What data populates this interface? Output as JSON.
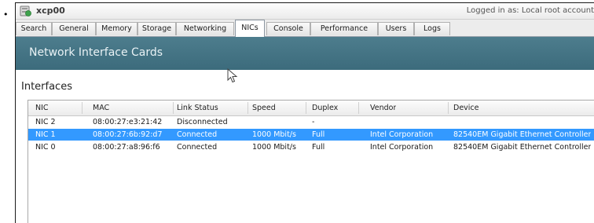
{
  "titlebar": {
    "host_name": "xcp00",
    "logged_in_text": "Logged in as: Local root account"
  },
  "tabs": [
    {
      "label": "Search",
      "active": false
    },
    {
      "label": "General",
      "active": false
    },
    {
      "label": "Memory",
      "active": false
    },
    {
      "label": "Storage",
      "active": false
    },
    {
      "label": "Networking",
      "active": false
    },
    {
      "label": "NICs",
      "active": true
    },
    {
      "label": "Console",
      "active": false
    },
    {
      "label": "Performance",
      "active": false
    },
    {
      "label": "Users",
      "active": false
    },
    {
      "label": "Logs",
      "active": false
    }
  ],
  "banner": {
    "title": "Network Interface Cards"
  },
  "interfaces": {
    "title": "Interfaces",
    "columns": [
      "NIC",
      "MAC",
      "Link Status",
      "Speed",
      "Duplex",
      "Vendor",
      "Device"
    ],
    "rows": [
      {
        "nic": "NIC 2",
        "mac": "08:00:27:e3:21:42",
        "link_status": "Disconnected",
        "speed": "",
        "duplex": "-",
        "vendor": "",
        "device": "",
        "selected": false
      },
      {
        "nic": "NIC 1",
        "mac": "08:00:27:6b:92:d7",
        "link_status": "Connected",
        "speed": "1000 Mbit/s",
        "duplex": "Full",
        "vendor": "Intel Corporation",
        "device": "82540EM Gigabit Ethernet Controller",
        "selected": true
      },
      {
        "nic": "NIC 0",
        "mac": "08:00:27:a8:96:f6",
        "link_status": "Connected",
        "speed": "1000 Mbit/s",
        "duplex": "Full",
        "vendor": "Intel Corporation",
        "device": "82540EM Gigabit Ethernet Controller",
        "selected": false
      }
    ]
  },
  "colors": {
    "banner": "#4a7a8a",
    "selection": "#3399ff",
    "host_icon": "#3fa34d"
  },
  "icons": [
    "server-icon",
    "mouse-pointer-icon"
  ]
}
